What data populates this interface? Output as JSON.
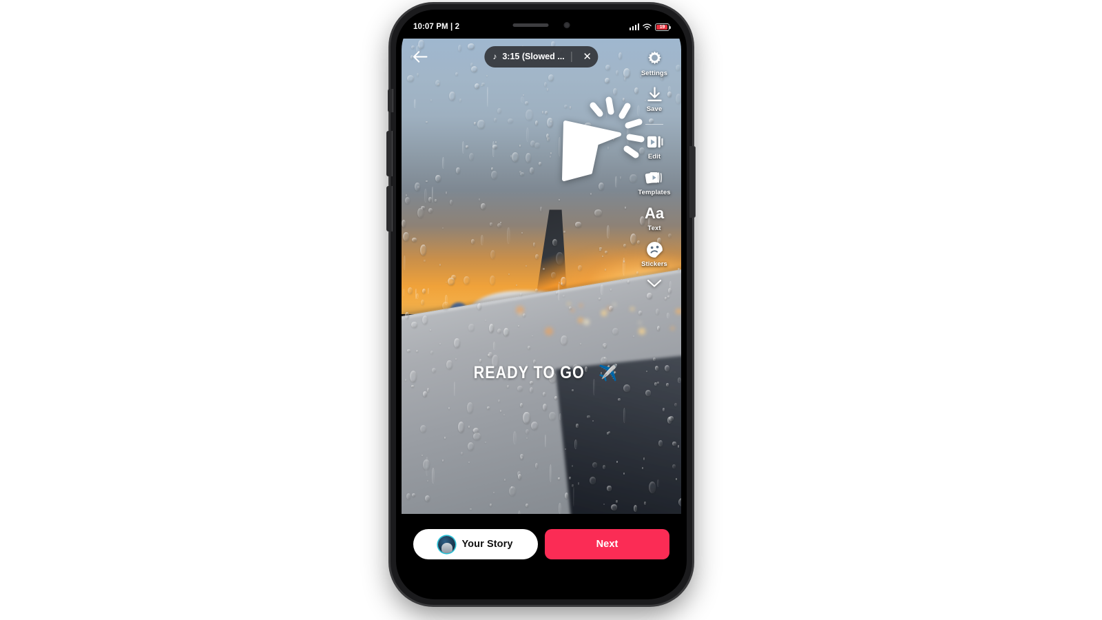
{
  "device": {
    "status_bar": {
      "time": "10:07 PM | 2",
      "signal_icon": "cellular-signal-icon",
      "wifi_icon": "wifi-icon",
      "battery_icon": "battery-icon",
      "battery_level": "19"
    },
    "notch": {
      "speaker_icon": "earpiece-speaker",
      "camera_icon": "front-camera"
    }
  },
  "editor": {
    "back_icon": "back-arrow-icon",
    "music_pill": {
      "note_icon": "music-note-icon",
      "label": "3:15 (Slowed ...",
      "close_icon": "close-icon"
    },
    "tools": [
      {
        "id": "settings",
        "label": "Settings",
        "icon": "gear-icon"
      },
      {
        "id": "save",
        "label": "Save",
        "icon": "download-arrow-icon"
      },
      {
        "id": "edit",
        "label": "Edit",
        "icon": "video-trim-icon"
      },
      {
        "id": "templates",
        "label": "Templates",
        "icon": "templates-cards-icon"
      },
      {
        "id": "text",
        "label": "Text",
        "icon": "text-aa-icon"
      },
      {
        "id": "stickers",
        "label": "Stickers",
        "icon": "sticker-smiley-icon"
      }
    ],
    "text_tool_glyph": "Aa",
    "collapse_icon": "chevron-down-icon",
    "caption": {
      "text": "READY TO GO",
      "emoji": "✈️"
    },
    "cursor": {
      "icon": "mouse-cursor-click-icon"
    }
  },
  "bottom_bar": {
    "story_button": {
      "label": "Your Story",
      "avatar_icon": "user-avatar"
    },
    "next_button": {
      "label": "Next"
    }
  },
  "colors": {
    "accent_next": "#fb2c55",
    "story_bg": "#ffffff",
    "battery_red": "#e8333f",
    "avatar_ring": "#27c3d8"
  }
}
